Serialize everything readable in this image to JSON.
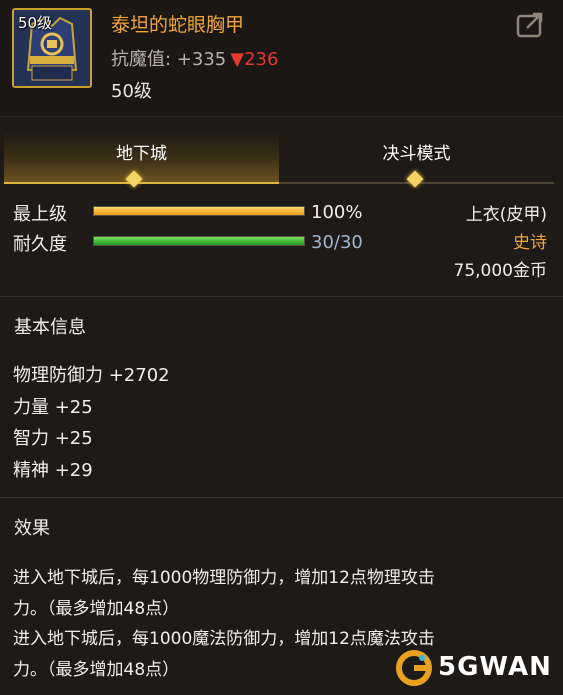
{
  "item": {
    "level_badge": "50级",
    "name": "泰坦的蛇眼胸甲",
    "resist_label": "抗魔值: +335",
    "resist_diff": "▼236",
    "required_level": "50级",
    "icon": "chest-armor-icon"
  },
  "header": {
    "share_icon": "share-icon"
  },
  "tabs": [
    {
      "label": "地下城",
      "active": true
    },
    {
      "label": "决斗模式",
      "active": false
    }
  ],
  "stats": {
    "grade_label": "最上级",
    "grade_value": "100%",
    "grade_fraction": 1.0,
    "durability_label": "耐久度",
    "durability_value": "30/30",
    "durability_fraction": 1.0
  },
  "meta": {
    "slot": "上衣(皮甲)",
    "rarity": "史诗",
    "price": "75,000金币"
  },
  "basic_info": {
    "title": "基本信息",
    "attributes": [
      "物理防御力 +2702",
      "力量 +25",
      "智力 +25",
      "精神 +29"
    ]
  },
  "effect": {
    "title": "效果",
    "lines": [
      "进入地下城后，每1000物理防御力，增加12点物理攻击",
      "力。（最多增加48点）",
      "进入地下城后，每1000魔法防御力，增加12点魔法攻击",
      "力。（最多增加48点）"
    ]
  },
  "watermark": {
    "text": "5GWAN",
    "icon": "5gwan-logo-icon"
  },
  "colors": {
    "item_name": "#f0a53a",
    "resist_down": "#e23a2f",
    "rarity": "#f0a53a",
    "tab_accent": "#e2b541"
  }
}
